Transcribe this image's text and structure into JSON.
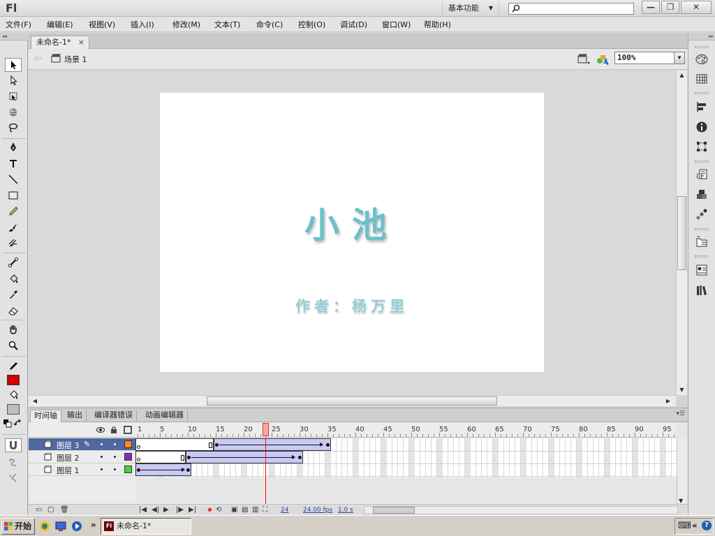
{
  "app": {
    "logo": "Fl",
    "workspace": "基本功能",
    "search_placeholder": ""
  },
  "window_buttons": {
    "minimize": "—",
    "restore": "❐",
    "close": "✕"
  },
  "menu": [
    "文件(F)",
    "编辑(E)",
    "视图(V)",
    "插入(I)",
    "修改(M)",
    "文本(T)",
    "命令(C)",
    "控制(O)",
    "调试(D)",
    "窗口(W)",
    "帮助(H)"
  ],
  "document": {
    "tab_label": "未命名-1*",
    "tab_close": "×",
    "scene": "场景 1",
    "zoom": "100%"
  },
  "stage": {
    "title": "小池",
    "author": "作者：杨万里",
    "title_color": "#6dc0c8",
    "background": "#ffffff"
  },
  "timeline": {
    "tabs": [
      "时间轴",
      "输出",
      "编译器错误",
      "动画编辑器"
    ],
    "ruler": [
      "1",
      "5",
      "10",
      "15",
      "20",
      "25",
      "30",
      "35",
      "40",
      "45",
      "50",
      "55",
      "60",
      "65",
      "70",
      "75",
      "80",
      "85",
      "90",
      "95"
    ],
    "current_frame": 24,
    "layers": [
      {
        "name": "图层 3",
        "color": "#ff8a1a",
        "selected": true,
        "editing": "✎"
      },
      {
        "name": "图层 2",
        "color": "#8a2ab8",
        "selected": false,
        "editing": ""
      },
      {
        "name": "图层 1",
        "color": "#3ad83a",
        "selected": false,
        "editing": ""
      }
    ],
    "status": {
      "frame": "24",
      "fps": "24.00 fps",
      "time": "1.0 s"
    }
  },
  "taskbar": {
    "start_label": "开始",
    "task_label": "未命名-1*",
    "task_icon": "Fl",
    "more": "»"
  },
  "colors": {
    "stroke": "#000000",
    "fill": "#ff0000",
    "selected_layer": "#5167a0",
    "playhead": "#e11111"
  }
}
